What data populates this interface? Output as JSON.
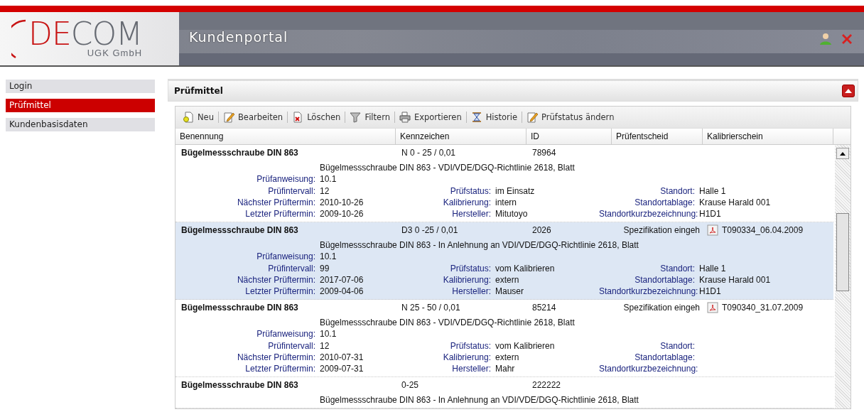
{
  "header": {
    "brand": {
      "part_1": "DE",
      "part_2": "COM",
      "subtitle": "UGK GmbH"
    },
    "title": "Kundenportal"
  },
  "sidebar": {
    "items": [
      {
        "label": "Login",
        "selected": false
      },
      {
        "label": "Prüfmittel",
        "selected": true
      },
      {
        "label": "Kundenbasisdaten",
        "selected": false
      }
    ]
  },
  "panel": {
    "title": "Prüfmittel",
    "toolbar": [
      {
        "kind": "new",
        "label": "Neu"
      },
      {
        "kind": "edit",
        "label": "Bearbeiten"
      },
      {
        "kind": "delete",
        "label": "Löschen"
      },
      {
        "kind": "filter",
        "label": "Filtern"
      },
      {
        "kind": "print",
        "label": "Exportieren"
      },
      {
        "kind": "history",
        "label": "Historie"
      },
      {
        "kind": "edit",
        "label": "Prüfstatus ändern"
      }
    ],
    "columns": [
      "Benennung",
      "Kennzeichen",
      "ID",
      "Prüfentscheid",
      "Kalibrierschein"
    ],
    "records": [
      {
        "selected": false,
        "benennung": "Bügelmessschraube DIN 863",
        "kennzeichen": "N 0 - 25 / 0,01",
        "id": "78964",
        "beschreibung": "Bügelmessschraube DIN 863 - VDI/VDE/DGQ-Richtlinie 2618, Blatt",
        "anweisung": {
          "label": "Prüfanweisung:",
          "value": "10.1"
        },
        "fields": [
          {
            "label": "Prüfintervall:",
            "value": "12"
          },
          {
            "label": "Prüfstatus:",
            "value": "im Einsatz"
          },
          {
            "label": "Standort:",
            "value": "Halle 1"
          },
          {
            "label": "Nächster Prüftermin:",
            "value": "2010-10-26"
          },
          {
            "label": "Kalibrierung:",
            "value": "intern"
          },
          {
            "label": "Standortablage:",
            "value": "Krause Harald 001"
          },
          {
            "label": "Letzter Prüftermin:",
            "value": "2009-10-26"
          },
          {
            "label": "Hersteller:",
            "value": "Mitutoyo"
          },
          {
            "label": "Standortkurzbezeichnung:",
            "value": "H1D1"
          }
        ]
      },
      {
        "selected": true,
        "benennung": "Bügelmessschraube DIN 863",
        "kennzeichen": "D3 0 -25 / 0,01",
        "id": "2026",
        "pruefentscheid": "Spezifikation eingeh",
        "kalibrierschein": "T090334_06.04.2009",
        "beschreibung": "Bügelmessschraube DIN 863 - In Anlehnung an VDI/VDE/DGQ-Richtlinie 2618, Blatt",
        "anweisung": {
          "label": "Prüfanweisung:",
          "value": "10.1"
        },
        "fields": [
          {
            "label": "Prüfintervall:",
            "value": "99"
          },
          {
            "label": "Prüfstatus:",
            "value": "vom Kalibrieren"
          },
          {
            "label": "Standort:",
            "value": "Halle 1"
          },
          {
            "label": "Nächster Prüftermin:",
            "value": "2017-07-06"
          },
          {
            "label": "Kalibrierung:",
            "value": "extern"
          },
          {
            "label": "Standortablage:",
            "value": "Krause Harald 001"
          },
          {
            "label": "Letzter Prüftermin:",
            "value": "2009-04-06"
          },
          {
            "label": "Hersteller:",
            "value": "Mauser"
          },
          {
            "label": "Standortkurzbezeichnung:",
            "value": "H1D1"
          }
        ]
      },
      {
        "selected": false,
        "benennung": "Bügelmessschraube DIN 863",
        "kennzeichen": "N 25 - 50 / 0,01",
        "id": "85214",
        "pruefentscheid": "Spezifikation eingeh",
        "kalibrierschein": "T090340_31.07.2009",
        "beschreibung": "Bügelmessschraube DIN 863 - VDI/VDE/DGQ-Richtlinie 2618, Blatt",
        "anweisung": {
          "label": "Prüfanweisung:",
          "value": "10.1"
        },
        "fields": [
          {
            "label": "Prüfintervall:",
            "value": "12"
          },
          {
            "label": "Prüfstatus:",
            "value": "vom Kalibrieren"
          },
          {
            "label": "Standort:"
          },
          {
            "label": "Nächster Prüftermin:",
            "value": "2010-07-31"
          },
          {
            "label": "Kalibrierung:",
            "value": "extern"
          },
          {
            "label": "Standortablage:"
          },
          {
            "label": "Letzter Prüftermin:",
            "value": "2009-07-31"
          },
          {
            "label": "Hersteller:",
            "value": "Mahr"
          },
          {
            "label": "Standortkurzbezeichnung:"
          }
        ]
      },
      {
        "selected": false,
        "benennung": "Bügelmessschraube DIN 863",
        "kennzeichen": "0-25",
        "id": "222222",
        "beschreibung": "Bügelmessschraube DIN 863 - In Anlehnung an VDI/VDE/DGQ-Richtlinie 2618, Blatt"
      }
    ]
  }
}
